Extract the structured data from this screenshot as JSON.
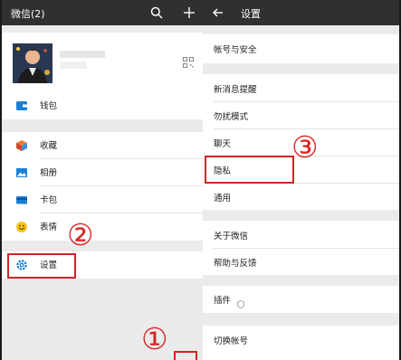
{
  "left_panel": {
    "title": "微信(2)",
    "header_icons": [
      "search-icon",
      "plus-icon"
    ],
    "profile": {
      "avatar": "avatar",
      "qr_icon": "qr-code-icon"
    },
    "menu": [
      {
        "id": "wallet",
        "label": "钱包",
        "icon": "wallet-icon"
      },
      {
        "id": "favorites",
        "label": "收藏",
        "icon": "cube-icon"
      },
      {
        "id": "album",
        "label": "相册",
        "icon": "photo-icon"
      },
      {
        "id": "cards",
        "label": "卡包",
        "icon": "card-icon"
      },
      {
        "id": "stickers",
        "label": "表情",
        "icon": "smiley-icon"
      },
      {
        "id": "settings",
        "label": "设置",
        "icon": "gear-icon"
      }
    ]
  },
  "right_panel": {
    "title": "设置",
    "back_icon": "back-arrow-icon",
    "items": [
      {
        "id": "account-security",
        "label": "帐号与安全"
      },
      {
        "id": "new-message-notify",
        "label": "新消息提醒"
      },
      {
        "id": "do-not-disturb",
        "label": "勿扰模式"
      },
      {
        "id": "chat",
        "label": "聊天"
      },
      {
        "id": "privacy",
        "label": "隐私"
      },
      {
        "id": "general",
        "label": "通用"
      },
      {
        "id": "about",
        "label": "关于微信"
      },
      {
        "id": "help-feedback",
        "label": "帮助与反馈"
      },
      {
        "id": "plugins",
        "label": "插件"
      },
      {
        "id": "switch-account",
        "label": "切换帐号"
      }
    ]
  },
  "annotations": {
    "step1": "①",
    "step2": "②",
    "step3": "③"
  },
  "colors": {
    "header_bg": "#303030",
    "page_bg": "#ebebeb",
    "annotation_red": "#d42424",
    "icon_blue": "#1a7fd6",
    "icon_orange": "#f0a020",
    "icon_yellow": "#f5c21b"
  }
}
